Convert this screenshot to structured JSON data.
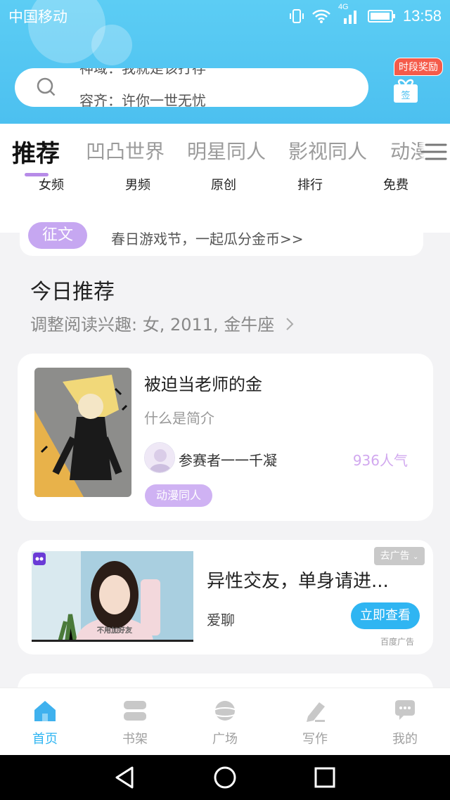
{
  "status_bar": {
    "carrier": "中国移动",
    "network": "4G",
    "time": "13:58"
  },
  "search": {
    "prev_hint": "神域：我就是该打存",
    "current_hint": "容齐：许你一世无忧"
  },
  "reward": {
    "badge": "时段奖励",
    "gift_label": "签"
  },
  "category_tabs": [
    {
      "label": "推荐",
      "active": true
    },
    {
      "label": "凹凸世界"
    },
    {
      "label": "明星同人"
    },
    {
      "label": "影视同人"
    },
    {
      "label": "动漫"
    }
  ],
  "sub_tabs": [
    "女频",
    "男频",
    "原创",
    "排行",
    "免费"
  ],
  "notice": {
    "tag": "征文",
    "text": "春日游戏节，一起瓜分金币>>"
  },
  "section": {
    "title": "今日推荐",
    "subtitle": "调整阅读兴趣: 女, 2011, 金牛座"
  },
  "book": {
    "title": "被迫当老师的金",
    "desc": "什么是简介",
    "author": "参赛者一一千凝",
    "popularity": "936人气",
    "tag": "动漫同人"
  },
  "ad": {
    "title": "异性交友，单身请进...",
    "brand": "爱聊",
    "close_label": "去广告",
    "cta": "立即查看",
    "source": "百度广告",
    "caption": "不用加好友"
  },
  "bottom_nav": [
    {
      "label": "首页",
      "icon": "home-icon",
      "active": true
    },
    {
      "label": "书架",
      "icon": "bookshelf-icon"
    },
    {
      "label": "广场",
      "icon": "planet-icon"
    },
    {
      "label": "写作",
      "icon": "pen-icon"
    },
    {
      "label": "我的",
      "icon": "chat-bubble-icon"
    }
  ],
  "colors": {
    "accent": "#2fb5f2",
    "purple": "#cfb2f3",
    "header": "#4cc0f0"
  }
}
